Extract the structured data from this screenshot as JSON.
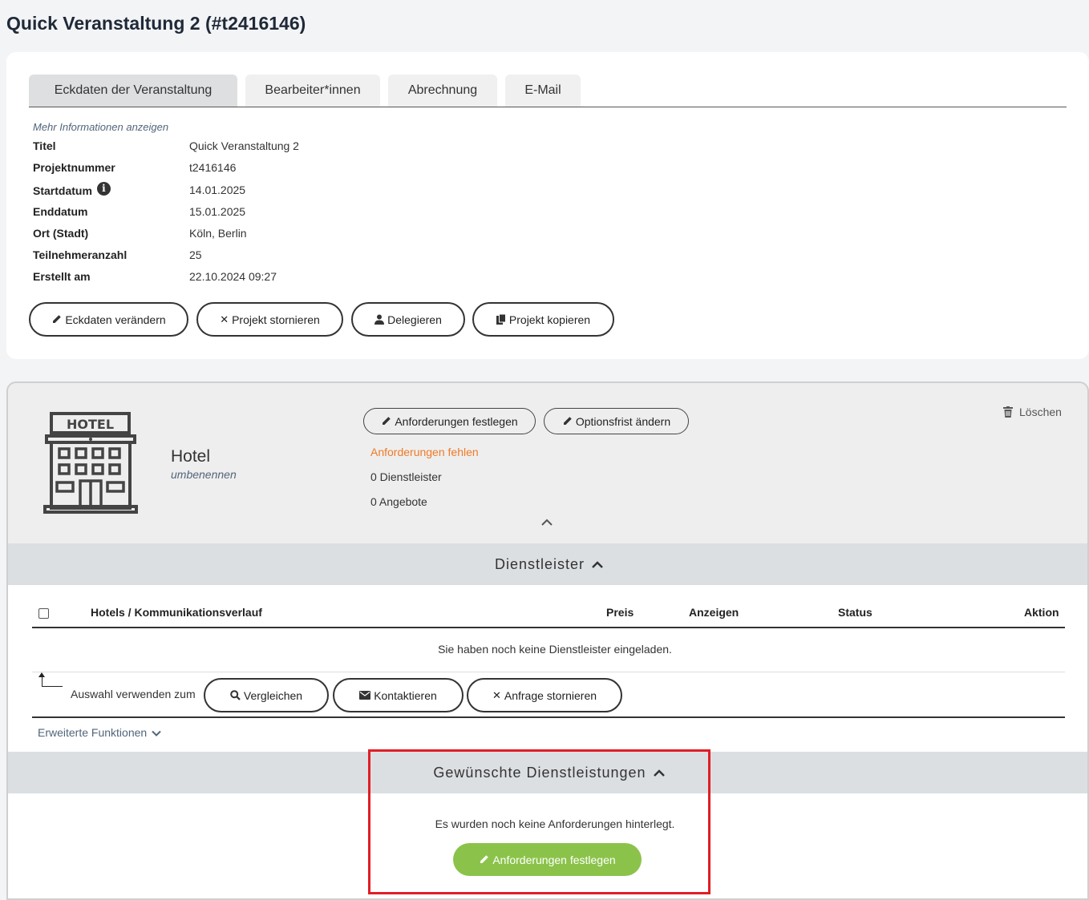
{
  "page": {
    "title": "Quick Veranstaltung 2 (#t2416146)"
  },
  "tabs": [
    {
      "label": "Eckdaten der Veranstaltung",
      "active": true
    },
    {
      "label": "Bearbeiter*innen",
      "active": false
    },
    {
      "label": "Abrechnung",
      "active": false
    },
    {
      "label": "E-Mail",
      "active": false
    }
  ],
  "details": {
    "more_info": "Mehr Informationen anzeigen",
    "fields": [
      {
        "label": "Titel",
        "value": "Quick Veranstaltung 2"
      },
      {
        "label": "Projektnummer",
        "value": "t2416146"
      },
      {
        "label": "Startdatum",
        "value": "14.01.2025",
        "info_icon": "info-icon"
      },
      {
        "label": "Enddatum",
        "value": "15.01.2025"
      },
      {
        "label": "Ort (Stadt)",
        "value": "Köln, Berlin"
      },
      {
        "label": "Teilnehmeranzahl",
        "value": "25"
      },
      {
        "label": "Erstellt am",
        "value": "22.10.2024 09:27"
      }
    ],
    "actions": [
      {
        "label": "Eckdaten verändern",
        "icon": "pencil-icon"
      },
      {
        "label": "Projekt stornieren",
        "icon": "times-icon"
      },
      {
        "label": "Delegieren",
        "icon": "user-icon"
      },
      {
        "label": "Projekt kopieren",
        "icon": "copy-icon"
      }
    ]
  },
  "service": {
    "icon_label": "HOTEL",
    "name": "Hotel",
    "rename": "umbenennen",
    "buttons": {
      "set_requirements": "Anforderungen festlegen",
      "change_option": "Optionsfrist ändern"
    },
    "status_missing": "Anforderungen fehlen",
    "providers_count": "0 Dienstleister",
    "offers_count": "0 Angebote",
    "delete_label": "Löschen",
    "collapse_icon": "^"
  },
  "providers": {
    "section_title": "Dienstleister",
    "columns": [
      "Hotels / Kommunikationsverlauf",
      "Preis",
      "Anzeigen",
      "Status",
      "Aktion"
    ],
    "empty_message": "Sie haben noch keine Dienstleister eingeladen.",
    "use_selection_label": "Auswahl verwenden zum",
    "actions": [
      {
        "label": "Vergleichen",
        "icon": "search-icon"
      },
      {
        "label": "Kontaktieren",
        "icon": "envelope-icon"
      },
      {
        "label": "Anfrage stornieren",
        "icon": "times-icon"
      }
    ],
    "extended_functions": "Erweiterte Funktionen"
  },
  "requested": {
    "section_title": "Gewünschte Dienstleistungen",
    "empty_message": "Es wurden noch keine Anforderungen hinterlegt.",
    "button_label": "Anforderungen festlegen"
  },
  "colors": {
    "accent_orange": "#f07a26",
    "button_green": "#8bc34a",
    "highlight_red": "#e01e26"
  }
}
